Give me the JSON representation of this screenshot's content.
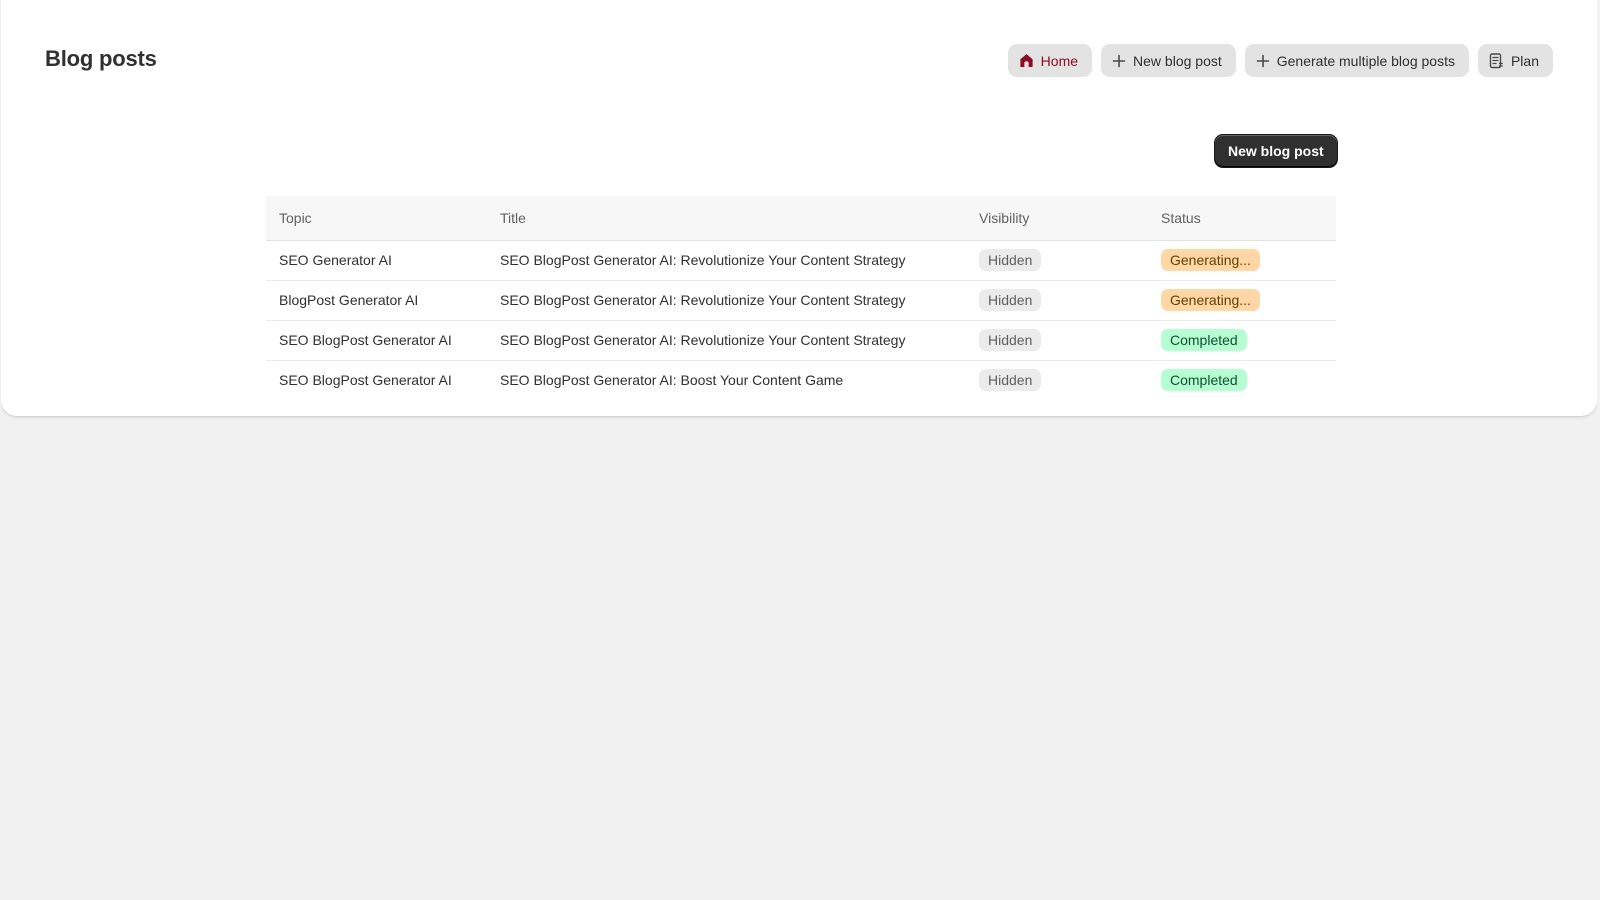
{
  "header": {
    "title": "Blog posts",
    "actions": {
      "home": "Home",
      "new_post": "New blog post",
      "generate_multiple": "Generate multiple blog posts",
      "plan": "Plan"
    }
  },
  "primary_button": "New blog post",
  "table": {
    "columns": {
      "topic": "Topic",
      "title": "Title",
      "visibility": "Visibility",
      "status": "Status"
    },
    "rows": [
      {
        "topic": "SEO Generator AI",
        "title": "SEO BlogPost Generator AI: Revolutionize Your Content Strategy",
        "visibility": "Hidden",
        "status": "Generating..."
      },
      {
        "topic": "BlogPost Generator AI",
        "title": "SEO BlogPost Generator AI: Revolutionize Your Content Strategy",
        "visibility": "Hidden",
        "status": "Generating..."
      },
      {
        "topic": "SEO BlogPost Generator AI",
        "title": "SEO BlogPost Generator AI: Revolutionize Your Content Strategy",
        "visibility": "Hidden",
        "status": "Completed"
      },
      {
        "topic": "SEO BlogPost Generator AI",
        "title": "SEO BlogPost Generator AI: Boost Your Content Game",
        "visibility": "Hidden",
        "status": "Completed"
      }
    ]
  },
  "colors": {
    "home_accent": "#8e0b21",
    "primary": "#303030",
    "generating_bg": "#ffd6a4",
    "completed_bg": "#b4fed2",
    "hidden_bg": "#ebebeb"
  },
  "icons": {
    "home": "home-icon",
    "new_post": "plus-icon",
    "generate_multiple": "plus-icon",
    "plan": "document-list-icon"
  }
}
